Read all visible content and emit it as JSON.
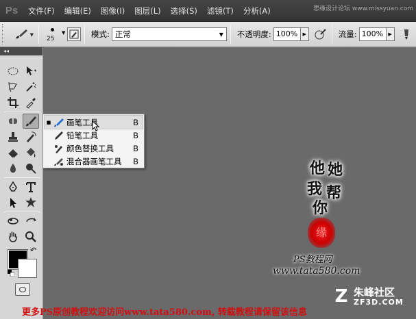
{
  "app": {
    "logo": "Ps"
  },
  "menubar": {
    "items": [
      "文件(F)",
      "编辑(E)",
      "图像(I)",
      "图层(L)",
      "选择(S)",
      "滤镜(T)",
      "分析(A)"
    ],
    "watermark": "思缘设计论坛 www.missyuan.com"
  },
  "options": {
    "brush_size": "25",
    "mode_label": "模式:",
    "mode_value": "正常",
    "opacity_label": "不透明度:",
    "opacity_value": "100%",
    "flow_label": "流量:",
    "flow_value": "100%"
  },
  "toolbox": {
    "collapse_label": "◂◂"
  },
  "flyout": {
    "items": [
      {
        "label": "画笔工具",
        "key": "B",
        "active": true
      },
      {
        "label": "铅笔工具",
        "key": "B",
        "active": false
      },
      {
        "label": "颜色替换工具",
        "key": "B",
        "active": false
      },
      {
        "label": "混合器画笔工具",
        "key": "B",
        "active": false
      }
    ]
  },
  "colors": {
    "foreground": "#000000",
    "background": "#ffffff",
    "accent_red": "#d01010"
  },
  "canvas": {
    "calligraphy": [
      "他",
      "她",
      "我",
      "帮",
      "你"
    ],
    "seal_text": "缘",
    "watermark_line1": "PS教程网",
    "watermark_line2": "www.tata580.com",
    "site_logo_letter": "Z",
    "site_name_cn": "朱峰社区",
    "site_name_en": "ZF3D.COM",
    "bottom_banner": "更多PS原创教程欢迎访问www.tata580.com, 转载教程请保留该信息"
  }
}
